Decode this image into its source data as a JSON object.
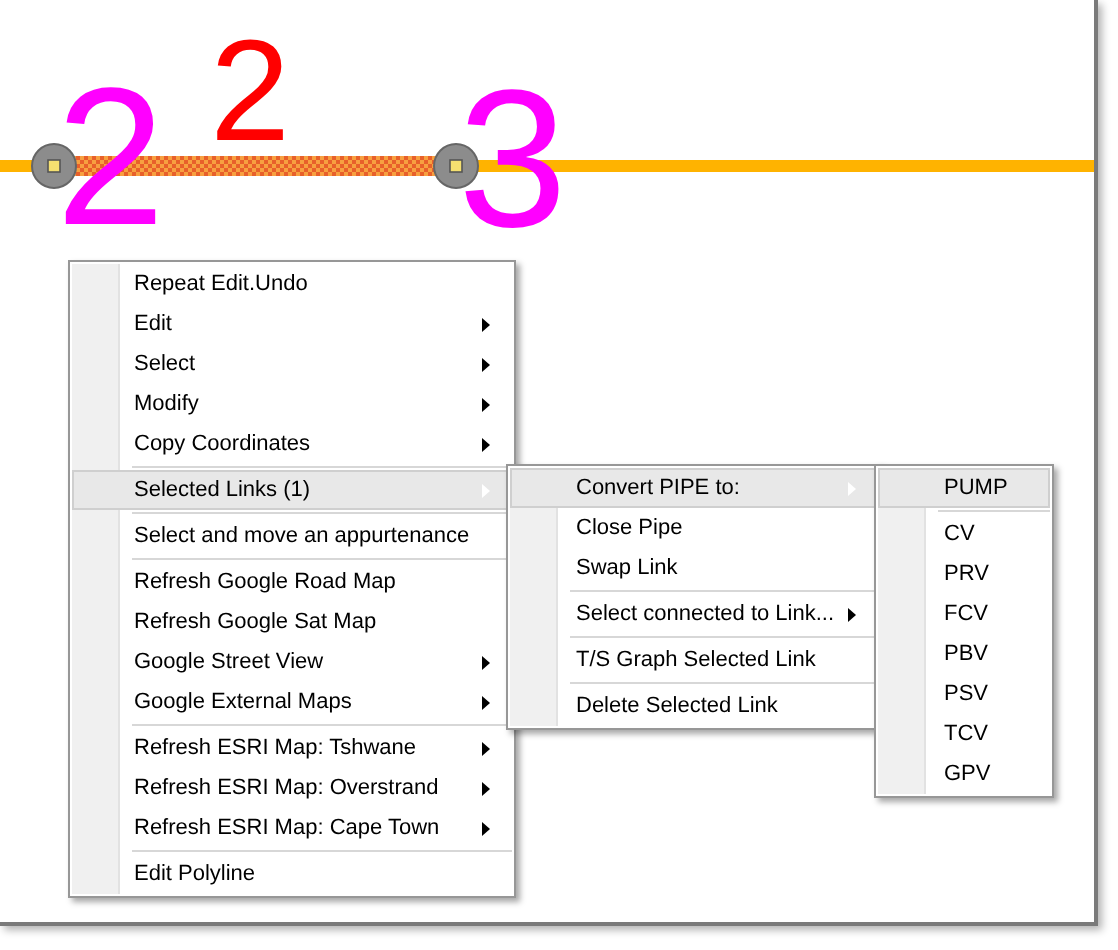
{
  "canvas": {
    "labels": [
      {
        "text": "2",
        "color": "#ff00ff"
      },
      {
        "text": "2",
        "color": "#ff0000"
      },
      {
        "text": "3",
        "color": "#ff00ff"
      }
    ]
  },
  "menus": [
    {
      "items": [
        {
          "kind": "item",
          "label": "Repeat Edit.Undo",
          "submenu": false,
          "selected": false
        },
        {
          "kind": "item",
          "label": "Edit",
          "submenu": true,
          "selected": false
        },
        {
          "kind": "item",
          "label": "Select",
          "submenu": true,
          "selected": false
        },
        {
          "kind": "item",
          "label": "Modify",
          "submenu": true,
          "selected": false
        },
        {
          "kind": "item",
          "label": "Copy Coordinates",
          "submenu": true,
          "selected": false
        },
        {
          "kind": "separator"
        },
        {
          "kind": "item",
          "label": "Selected Links (1)",
          "submenu": true,
          "selected": true
        },
        {
          "kind": "separator"
        },
        {
          "kind": "item",
          "label": "Select and move an appurtenance",
          "submenu": false,
          "selected": false
        },
        {
          "kind": "separator"
        },
        {
          "kind": "item",
          "label": "Refresh Google Road Map",
          "submenu": false,
          "selected": false
        },
        {
          "kind": "item",
          "label": "Refresh Google Sat Map",
          "submenu": false,
          "selected": false
        },
        {
          "kind": "item",
          "label": "Google Street View",
          "submenu": true,
          "selected": false
        },
        {
          "kind": "item",
          "label": "Google External Maps",
          "submenu": true,
          "selected": false
        },
        {
          "kind": "separator"
        },
        {
          "kind": "item",
          "label": "Refresh ESRI Map: Tshwane",
          "submenu": true,
          "selected": false
        },
        {
          "kind": "item",
          "label": "Refresh ESRI Map: Overstrand",
          "submenu": true,
          "selected": false
        },
        {
          "kind": "item",
          "label": "Refresh ESRI Map: Cape Town",
          "submenu": true,
          "selected": false
        },
        {
          "kind": "separator"
        },
        {
          "kind": "item",
          "label": "Edit Polyline",
          "submenu": false,
          "selected": false
        }
      ]
    },
    {
      "items": [
        {
          "kind": "item",
          "label": "Convert PIPE to:",
          "submenu": true,
          "selected": true
        },
        {
          "kind": "item",
          "label": "Close Pipe",
          "submenu": false,
          "selected": false
        },
        {
          "kind": "item",
          "label": "Swap Link",
          "submenu": false,
          "selected": false
        },
        {
          "kind": "separator"
        },
        {
          "kind": "item",
          "label": "Select connected to Link...",
          "submenu": true,
          "selected": false
        },
        {
          "kind": "separator"
        },
        {
          "kind": "item",
          "label": "T/S Graph Selected Link",
          "submenu": false,
          "selected": false
        },
        {
          "kind": "separator"
        },
        {
          "kind": "item",
          "label": "Delete Selected Link",
          "submenu": false,
          "selected": false
        }
      ]
    },
    {
      "items": [
        {
          "kind": "item",
          "label": "PUMP",
          "submenu": false,
          "selected": true
        },
        {
          "kind": "separator"
        },
        {
          "kind": "item",
          "label": "CV",
          "submenu": false,
          "selected": false
        },
        {
          "kind": "item",
          "label": "PRV",
          "submenu": false,
          "selected": false
        },
        {
          "kind": "item",
          "label": "FCV",
          "submenu": false,
          "selected": false
        },
        {
          "kind": "item",
          "label": "PBV",
          "submenu": false,
          "selected": false
        },
        {
          "kind": "item",
          "label": "PSV",
          "submenu": false,
          "selected": false
        },
        {
          "kind": "item",
          "label": "TCV",
          "submenu": false,
          "selected": false
        },
        {
          "kind": "item",
          "label": "GPV",
          "submenu": false,
          "selected": false
        }
      ]
    }
  ]
}
